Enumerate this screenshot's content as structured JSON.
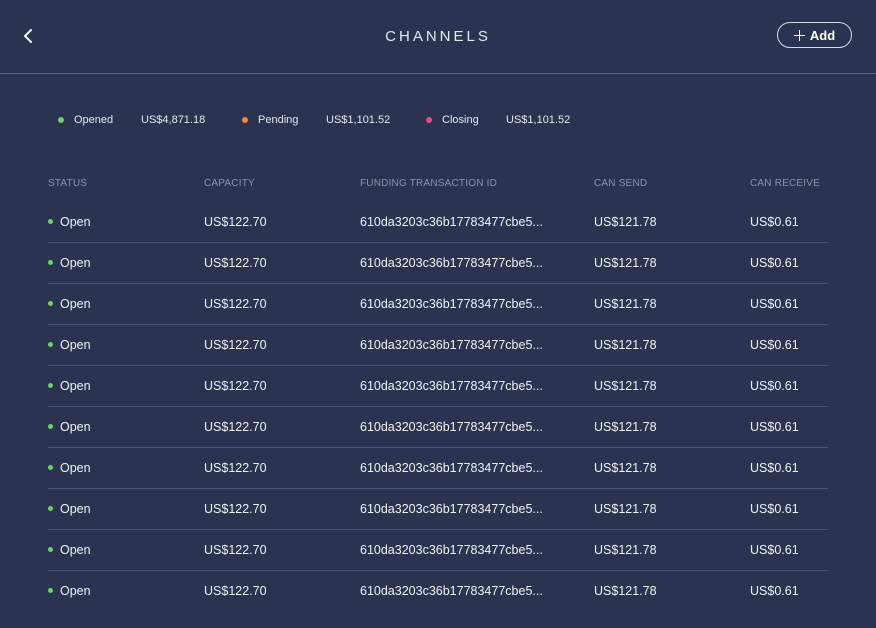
{
  "header": {
    "title": "CHANNELS",
    "add_label": "Add",
    "back_icon": "chevron-left-icon",
    "add_icon": "plus-icon"
  },
  "summary": [
    {
      "label": "Opened",
      "amount": "US$4,871.18",
      "color": "#6bd36b"
    },
    {
      "label": "Pending",
      "amount": "US$1,101.52",
      "color": "#f08a3c"
    },
    {
      "label": "Closing",
      "amount": "US$1,101.52",
      "color": "#e44b86"
    }
  ],
  "table": {
    "columns": [
      "STATUS",
      "CAPACITY",
      "FUNDING TRANSACTION ID",
      "CAN SEND",
      "CAN RECEIVE"
    ],
    "status_color": "#6bd36b",
    "rows": [
      {
        "status": "Open",
        "capacity": "US$122.70",
        "funding": "610da3203c36b17783477cbe5...",
        "can_send": "US$121.78",
        "can_receive": "US$0.61"
      },
      {
        "status": "Open",
        "capacity": "US$122.70",
        "funding": "610da3203c36b17783477cbe5...",
        "can_send": "US$121.78",
        "can_receive": "US$0.61"
      },
      {
        "status": "Open",
        "capacity": "US$122.70",
        "funding": "610da3203c36b17783477cbe5...",
        "can_send": "US$121.78",
        "can_receive": "US$0.61"
      },
      {
        "status": "Open",
        "capacity": "US$122.70",
        "funding": "610da3203c36b17783477cbe5...",
        "can_send": "US$121.78",
        "can_receive": "US$0.61"
      },
      {
        "status": "Open",
        "capacity": "US$122.70",
        "funding": "610da3203c36b17783477cbe5...",
        "can_send": "US$121.78",
        "can_receive": "US$0.61"
      },
      {
        "status": "Open",
        "capacity": "US$122.70",
        "funding": "610da3203c36b17783477cbe5...",
        "can_send": "US$121.78",
        "can_receive": "US$0.61"
      },
      {
        "status": "Open",
        "capacity": "US$122.70",
        "funding": "610da3203c36b17783477cbe5...",
        "can_send": "US$121.78",
        "can_receive": "US$0.61"
      },
      {
        "status": "Open",
        "capacity": "US$122.70",
        "funding": "610da3203c36b17783477cbe5...",
        "can_send": "US$121.78",
        "can_receive": "US$0.61"
      },
      {
        "status": "Open",
        "capacity": "US$122.70",
        "funding": "610da3203c36b17783477cbe5...",
        "can_send": "US$121.78",
        "can_receive": "US$0.61"
      },
      {
        "status": "Open",
        "capacity": "US$122.70",
        "funding": "610da3203c36b17783477cbe5...",
        "can_send": "US$121.78",
        "can_receive": "US$0.61"
      }
    ]
  }
}
